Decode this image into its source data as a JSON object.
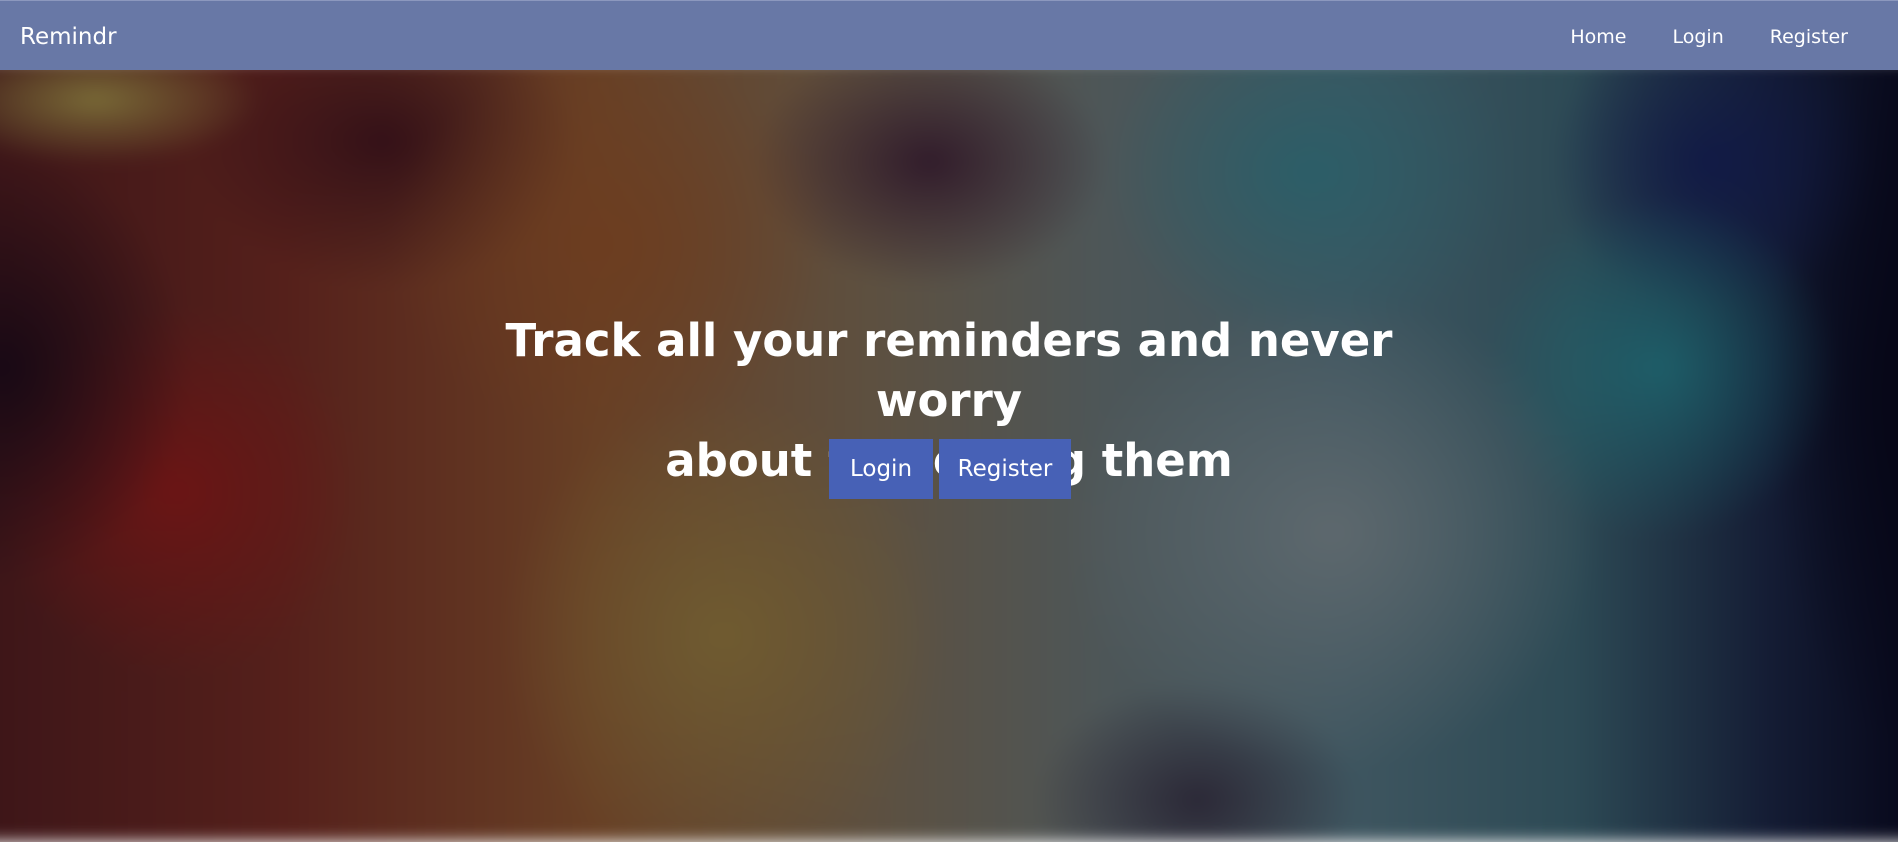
{
  "navbar": {
    "brand": "Remindr",
    "links": [
      {
        "label": "Home"
      },
      {
        "label": "Login"
      },
      {
        "label": "Register"
      }
    ],
    "background_color": "#6878a6"
  },
  "hero": {
    "headline_line1": "Track all your reminders and never worry",
    "headline_line2": "about forgetting them",
    "buttons": {
      "login_label": "Login",
      "register_label": "Register"
    },
    "button_color": "#4761b6"
  }
}
